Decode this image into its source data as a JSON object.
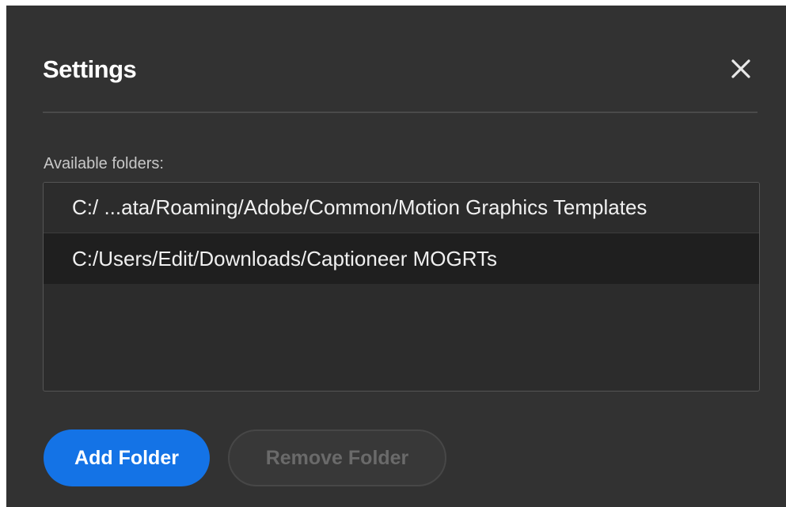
{
  "dialog": {
    "title": "Settings",
    "close_icon": "close-icon",
    "folders_label": "Available folders:",
    "folders": [
      "C:/  ...ata/Roaming/Adobe/Common/Motion Graphics Templates",
      "C:/Users/Edit/Downloads/Captioneer MOGRTs"
    ],
    "add_button_label": "Add Folder",
    "remove_button_label": "Remove Folder"
  },
  "colors": {
    "dialog_bg": "#323232",
    "accent": "#1473e6",
    "selected_row": "#1f1f1f"
  }
}
